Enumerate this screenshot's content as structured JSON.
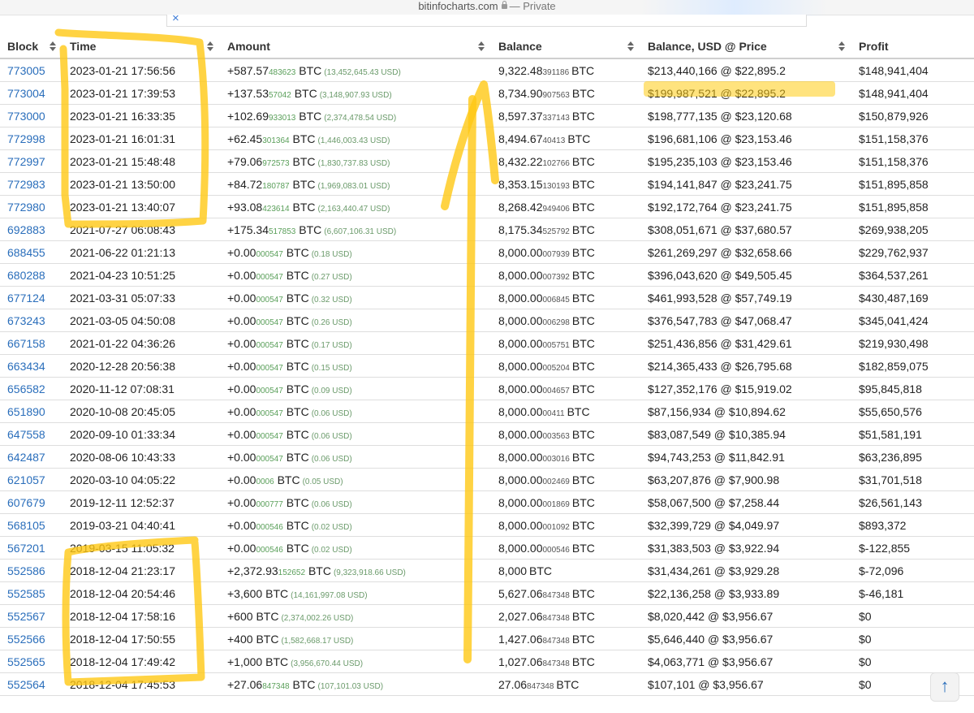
{
  "browser": {
    "host": "bitinfocharts.com",
    "mode": "— Private"
  },
  "ad": {
    "close_glyph": "×"
  },
  "table": {
    "headers": [
      "Block",
      "Time",
      "Amount",
      "Balance",
      "Balance, USD @ Price",
      "Profit"
    ],
    "rows": [
      {
        "block": "773005",
        "time": "2023-01-21 17:56:56",
        "amt_main": "+587.57",
        "amt_frac": "483623",
        "amt_unit": "BTC",
        "amt_usd": "(13,452,645.43 USD)",
        "bal_main": "9,322.48",
        "bal_frac": "391186",
        "bal_unit": "BTC",
        "usd_price": "$213,440,166 @ $22,895.2",
        "profit": "$148,941,404"
      },
      {
        "block": "773004",
        "time": "2023-01-21 17:39:53",
        "amt_main": "+137.53",
        "amt_frac": "57042",
        "amt_unit": "BTC",
        "amt_usd": "(3,148,907.93 USD)",
        "bal_main": "8,734.90",
        "bal_frac": "907563",
        "bal_unit": "BTC",
        "usd_price": "$199,987,521 @ $22,895.2",
        "profit": "$148,941,404"
      },
      {
        "block": "773000",
        "time": "2023-01-21 16:33:35",
        "amt_main": "+102.69",
        "amt_frac": "933013",
        "amt_unit": "BTC",
        "amt_usd": "(2,374,478.54 USD)",
        "bal_main": "8,597.37",
        "bal_frac": "337143",
        "bal_unit": "BTC",
        "usd_price": "$198,777,135 @ $23,120.68",
        "profit": "$150,879,926"
      },
      {
        "block": "772998",
        "time": "2023-01-21 16:01:31",
        "amt_main": "+62.45",
        "amt_frac": "301364",
        "amt_unit": "BTC",
        "amt_usd": "(1,446,003.43 USD)",
        "bal_main": "8,494.67",
        "bal_frac": "40413",
        "bal_unit": "BTC",
        "usd_price": "$196,681,106 @ $23,153.46",
        "profit": "$151,158,376"
      },
      {
        "block": "772997",
        "time": "2023-01-21 15:48:48",
        "amt_main": "+79.06",
        "amt_frac": "972573",
        "amt_unit": "BTC",
        "amt_usd": "(1,830,737.83 USD)",
        "bal_main": "8,432.22",
        "bal_frac": "102766",
        "bal_unit": "BTC",
        "usd_price": "$195,235,103 @ $23,153.46",
        "profit": "$151,158,376"
      },
      {
        "block": "772983",
        "time": "2023-01-21 13:50:00",
        "amt_main": "+84.72",
        "amt_frac": "180787",
        "amt_unit": "BTC",
        "amt_usd": "(1,969,083.01 USD)",
        "bal_main": "8,353.15",
        "bal_frac": "130193",
        "bal_unit": "BTC",
        "usd_price": "$194,141,847 @ $23,241.75",
        "profit": "$151,895,858"
      },
      {
        "block": "772980",
        "time": "2023-01-21 13:40:07",
        "amt_main": "+93.08",
        "amt_frac": "423614",
        "amt_unit": "BTC",
        "amt_usd": "(2,163,440.47 USD)",
        "bal_main": "8,268.42",
        "bal_frac": "949406",
        "bal_unit": "BTC",
        "usd_price": "$192,172,764 @ $23,241.75",
        "profit": "$151,895,858"
      },
      {
        "block": "692883",
        "time": "2021-07-27 06:08:43",
        "amt_main": "+175.34",
        "amt_frac": "517853",
        "amt_unit": "BTC",
        "amt_usd": "(6,607,106.31 USD)",
        "bal_main": "8,175.34",
        "bal_frac": "525792",
        "bal_unit": "BTC",
        "usd_price": "$308,051,671 @ $37,680.57",
        "profit": "$269,938,205"
      },
      {
        "block": "688455",
        "time": "2021-06-22 01:21:13",
        "amt_main": "+0.00",
        "amt_frac": "000547",
        "amt_unit": "BTC",
        "amt_usd": "(0.18 USD)",
        "bal_main": "8,000.00",
        "bal_frac": "007939",
        "bal_unit": "BTC",
        "usd_price": "$261,269,297 @ $32,658.66",
        "profit": "$229,762,937"
      },
      {
        "block": "680288",
        "time": "2021-04-23 10:51:25",
        "amt_main": "+0.00",
        "amt_frac": "000547",
        "amt_unit": "BTC",
        "amt_usd": "(0.27 USD)",
        "bal_main": "8,000.00",
        "bal_frac": "007392",
        "bal_unit": "BTC",
        "usd_price": "$396,043,620 @ $49,505.45",
        "profit": "$364,537,261"
      },
      {
        "block": "677124",
        "time": "2021-03-31 05:07:33",
        "amt_main": "+0.00",
        "amt_frac": "000547",
        "amt_unit": "BTC",
        "amt_usd": "(0.32 USD)",
        "bal_main": "8,000.00",
        "bal_frac": "006845",
        "bal_unit": "BTC",
        "usd_price": "$461,993,528 @ $57,749.19",
        "profit": "$430,487,169"
      },
      {
        "block": "673243",
        "time": "2021-03-05 04:50:08",
        "amt_main": "+0.00",
        "amt_frac": "000547",
        "amt_unit": "BTC",
        "amt_usd": "(0.26 USD)",
        "bal_main": "8,000.00",
        "bal_frac": "006298",
        "bal_unit": "BTC",
        "usd_price": "$376,547,783 @ $47,068.47",
        "profit": "$345,041,424"
      },
      {
        "block": "667158",
        "time": "2021-01-22 04:36:26",
        "amt_main": "+0.00",
        "amt_frac": "000547",
        "amt_unit": "BTC",
        "amt_usd": "(0.17 USD)",
        "bal_main": "8,000.00",
        "bal_frac": "005751",
        "bal_unit": "BTC",
        "usd_price": "$251,436,856 @ $31,429.61",
        "profit": "$219,930,498"
      },
      {
        "block": "663434",
        "time": "2020-12-28 20:56:38",
        "amt_main": "+0.00",
        "amt_frac": "000547",
        "amt_unit": "BTC",
        "amt_usd": "(0.15 USD)",
        "bal_main": "8,000.00",
        "bal_frac": "005204",
        "bal_unit": "BTC",
        "usd_price": "$214,365,433 @ $26,795.68",
        "profit": "$182,859,075"
      },
      {
        "block": "656582",
        "time": "2020-11-12 07:08:31",
        "amt_main": "+0.00",
        "amt_frac": "000547",
        "amt_unit": "BTC",
        "amt_usd": "(0.09 USD)",
        "bal_main": "8,000.00",
        "bal_frac": "004657",
        "bal_unit": "BTC",
        "usd_price": "$127,352,176 @ $15,919.02",
        "profit": "$95,845,818"
      },
      {
        "block": "651890",
        "time": "2020-10-08 20:45:05",
        "amt_main": "+0.00",
        "amt_frac": "000547",
        "amt_unit": "BTC",
        "amt_usd": "(0.06 USD)",
        "bal_main": "8,000.00",
        "bal_frac": "00411",
        "bal_unit": "BTC",
        "usd_price": "$87,156,934 @ $10,894.62",
        "profit": "$55,650,576"
      },
      {
        "block": "647558",
        "time": "2020-09-10 01:33:34",
        "amt_main": "+0.00",
        "amt_frac": "000547",
        "amt_unit": "BTC",
        "amt_usd": "(0.06 USD)",
        "bal_main": "8,000.00",
        "bal_frac": "003563",
        "bal_unit": "BTC",
        "usd_price": "$83,087,549 @ $10,385.94",
        "profit": "$51,581,191"
      },
      {
        "block": "642487",
        "time": "2020-08-06 10:43:33",
        "amt_main": "+0.00",
        "amt_frac": "000547",
        "amt_unit": "BTC",
        "amt_usd": "(0.06 USD)",
        "bal_main": "8,000.00",
        "bal_frac": "003016",
        "bal_unit": "BTC",
        "usd_price": "$94,743,253 @ $11,842.91",
        "profit": "$63,236,895"
      },
      {
        "block": "621057",
        "time": "2020-03-10 04:05:22",
        "amt_main": "+0.00",
        "amt_frac": "0006",
        "amt_unit": "BTC",
        "amt_usd": "(0.05 USD)",
        "bal_main": "8,000.00",
        "bal_frac": "002469",
        "bal_unit": "BTC",
        "usd_price": "$63,207,876 @ $7,900.98",
        "profit": "$31,701,518"
      },
      {
        "block": "607679",
        "time": "2019-12-11 12:52:37",
        "amt_main": "+0.00",
        "amt_frac": "000777",
        "amt_unit": "BTC",
        "amt_usd": "(0.06 USD)",
        "bal_main": "8,000.00",
        "bal_frac": "001869",
        "bal_unit": "BTC",
        "usd_price": "$58,067,500 @ $7,258.44",
        "profit": "$26,561,143"
      },
      {
        "block": "568105",
        "time": "2019-03-21 04:40:41",
        "amt_main": "+0.00",
        "amt_frac": "000546",
        "amt_unit": "BTC",
        "amt_usd": "(0.02 USD)",
        "bal_main": "8,000.00",
        "bal_frac": "001092",
        "bal_unit": "BTC",
        "usd_price": "$32,399,729 @ $4,049.97",
        "profit": "$893,372"
      },
      {
        "block": "567201",
        "time": "2019-03-15 11:05:32",
        "amt_main": "+0.00",
        "amt_frac": "000546",
        "amt_unit": "BTC",
        "amt_usd": "(0.02 USD)",
        "bal_main": "8,000.00",
        "bal_frac": "000546",
        "bal_unit": "BTC",
        "usd_price": "$31,383,503 @ $3,922.94",
        "profit": "$-122,855"
      },
      {
        "block": "552586",
        "time": "2018-12-04 21:23:17",
        "amt_main": "+2,372.93",
        "amt_frac": "152652",
        "amt_unit": "BTC",
        "amt_usd": "(9,323,918.66 USD)",
        "bal_main": "8,000",
        "bal_frac": "",
        "bal_unit": "BTC",
        "usd_price": "$31,434,261 @ $3,929.28",
        "profit": "$-72,096"
      },
      {
        "block": "552585",
        "time": "2018-12-04 20:54:46",
        "amt_main": "+3,600",
        "amt_frac": "",
        "amt_unit": "BTC",
        "amt_usd": "(14,161,997.08 USD)",
        "bal_main": "5,627.06",
        "bal_frac": "847348",
        "bal_unit": "BTC",
        "usd_price": "$22,136,258 @ $3,933.89",
        "profit": "$-46,181"
      },
      {
        "block": "552567",
        "time": "2018-12-04 17:58:16",
        "amt_main": "+600",
        "amt_frac": "",
        "amt_unit": "BTC",
        "amt_usd": "(2,374,002.26 USD)",
        "bal_main": "2,027.06",
        "bal_frac": "847348",
        "bal_unit": "BTC",
        "usd_price": "$8,020,442 @ $3,956.67",
        "profit": "$0"
      },
      {
        "block": "552566",
        "time": "2018-12-04 17:50:55",
        "amt_main": "+400",
        "amt_frac": "",
        "amt_unit": "BTC",
        "amt_usd": "(1,582,668.17 USD)",
        "bal_main": "1,427.06",
        "bal_frac": "847348",
        "bal_unit": "BTC",
        "usd_price": "$5,646,440 @ $3,956.67",
        "profit": "$0"
      },
      {
        "block": "552565",
        "time": "2018-12-04 17:49:42",
        "amt_main": "+1,000",
        "amt_frac": "",
        "amt_unit": "BTC",
        "amt_usd": "(3,956,670.44 USD)",
        "bal_main": "1,027.06",
        "bal_frac": "847348",
        "bal_unit": "BTC",
        "usd_price": "$4,063,771 @ $3,956.67",
        "profit": "$0"
      },
      {
        "block": "552564",
        "time": "2018-12-04 17:45:53",
        "amt_main": "+27.06",
        "amt_frac": "847348",
        "amt_unit": "BTC",
        "amt_usd": "(107,101.03 USD)",
        "bal_main": "27.06",
        "bal_frac": "847348",
        "bal_unit": "BTC",
        "usd_price": "$107,101 @ $3,956.67",
        "profit": "$0"
      }
    ]
  },
  "highlight_color": "#ffc814",
  "scroll_top": {
    "icon": "arrow-up-icon",
    "glyph": "↑"
  }
}
